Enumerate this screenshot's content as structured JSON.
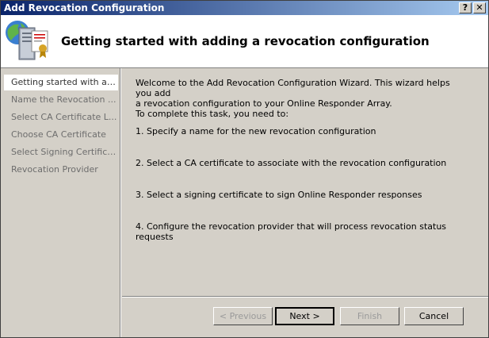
{
  "window": {
    "title": "Add Revocation Configuration",
    "help_glyph": "?",
    "close_glyph": "✕"
  },
  "header": {
    "heading": "Getting started with adding a revocation configuration",
    "logo_icon": "server-certificate-icon"
  },
  "sidebar": {
    "items": [
      {
        "label": "Getting started with ad..."
      },
      {
        "label": "Name the Revocation ..."
      },
      {
        "label": "Select CA Certificate L..."
      },
      {
        "label": "Choose CA Certificate"
      },
      {
        "label": "Select Signing Certificate"
      },
      {
        "label": "Revocation Provider"
      }
    ],
    "active_index": 0
  },
  "content": {
    "intro_line1": "Welcome to the Add Revocation Configuration Wizard. This wizard helps you add",
    "intro_line2": "a revocation configuration to your Online Responder Array.",
    "intro_line3": "To complete this task, you need to:",
    "steps": [
      "1. Specify a name for the new revocation configuration",
      "2. Select a CA certificate to associate with the revocation configuration",
      "3. Select a signing certificate to sign Online Responder responses",
      "4. Configure the revocation provider that will process revocation status requests"
    ]
  },
  "buttons": {
    "previous": "< Previous",
    "next": "Next >",
    "finish": "Finish",
    "cancel": "Cancel"
  },
  "colors": {
    "titlebar_start": "#0a246a",
    "titlebar_end": "#a6caf0",
    "dialog_face": "#d4d0c8"
  }
}
